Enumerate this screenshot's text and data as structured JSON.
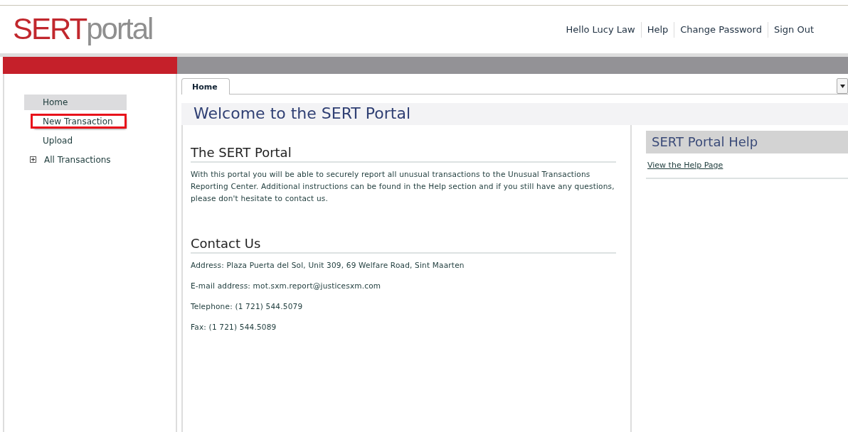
{
  "header": {
    "logo": {
      "strong": "SERT",
      "light": "portal"
    },
    "greeting": "Hello Lucy Law",
    "links": [
      "Help",
      "Change Password",
      "Sign Out"
    ]
  },
  "sidebar": {
    "items": [
      {
        "label": "Home",
        "selected": true,
        "highlighted": false,
        "expandable": false
      },
      {
        "label": "New Transaction",
        "selected": false,
        "highlighted": true,
        "expandable": false
      },
      {
        "label": "Upload",
        "selected": false,
        "highlighted": false,
        "expandable": false
      },
      {
        "label": "All Transactions",
        "selected": false,
        "highlighted": false,
        "expandable": true
      }
    ]
  },
  "tabs": [
    {
      "label": "Home",
      "selected": true
    }
  ],
  "page_title": "Welcome to the SERT Portal",
  "sections": [
    {
      "heading": "The SERT Portal",
      "paragraphs": [
        "With this portal you will be able to securely report all unusual transactions to the Unusual Transactions Reporting Center. Additional instructions can be found in the Help section and if you still have any questions, please don't hesitate to contact us."
      ]
    },
    {
      "heading": "Contact Us",
      "paragraphs": [
        "Address: Plaza Puerta del Sol, Unit 309, 69 Welfare Road, Sint Maarten",
        "E-mail address: mot.sxm.report@justicesxm.com",
        "Telephone: (1 721) 544.5079",
        "Fax: (1 721) 544.5089"
      ]
    }
  ],
  "help_panel": {
    "title": "SERT Portal Help",
    "link": "View the Help Page"
  }
}
